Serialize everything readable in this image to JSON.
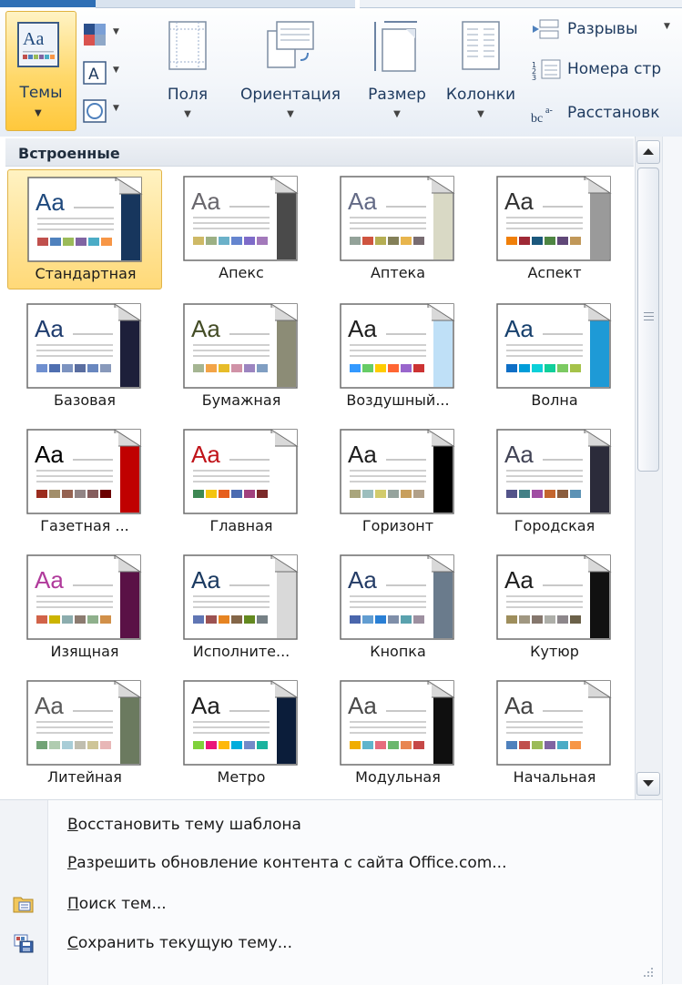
{
  "ribbon": {
    "themes_label": "Темы",
    "buttons": {
      "margins": "Поля",
      "orientation": "Ориентация",
      "size": "Размер",
      "columns": "Колонки"
    },
    "page_setup_rows": {
      "breaks": "Разрывы",
      "line_numbers": "Номера стр",
      "hyphenation": "Расстановк"
    }
  },
  "gallery": {
    "section_header": "Встроенные",
    "selected": "Стандартная",
    "themes": [
      {
        "name": "Стандартная",
        "title_color": "#1f497d",
        "accent_strip": "#17365d",
        "swatches": [
          "#c0504d",
          "#4f81bd",
          "#9bbb59",
          "#8064a2",
          "#4bacc6",
          "#f79646"
        ]
      },
      {
        "name": "Апекс",
        "title_color": "#69676d",
        "accent_strip": "#4a4a4a",
        "swatches": [
          "#ceb966",
          "#9cb084",
          "#6bb1c9",
          "#6585cf",
          "#7e6bc9",
          "#a379bb"
        ]
      },
      {
        "name": "Аптека",
        "title_color": "#646b86",
        "accent_strip": "#d9d9c5",
        "swatches": [
          "#93a299",
          "#cf543f",
          "#b5ae53",
          "#848058",
          "#e8b54d",
          "#786c71"
        ]
      },
      {
        "name": "Аспект",
        "title_color": "#323232",
        "accent_strip": "#9a9a9a",
        "swatches": [
          "#f07f09",
          "#9f2936",
          "#1b587c",
          "#4e8542",
          "#604878",
          "#c19859"
        ]
      },
      {
        "name": "Базовая",
        "title_color": "#1f3c6e",
        "accent_strip": "#1d1f3a",
        "swatches": [
          "#6f8fcf",
          "#4f6fb0",
          "#7c93c0",
          "#5a6ea0",
          "#6987bf",
          "#8899bb"
        ]
      },
      {
        "name": "Бумажная",
        "title_color": "#444d26",
        "accent_strip": "#8c8c76",
        "swatches": [
          "#a5b592",
          "#f3a447",
          "#e7bc29",
          "#d092a7",
          "#9c85c0",
          "#809ec2"
        ]
      },
      {
        "name": "Воздушный...",
        "title_color": "#1f1f1f",
        "accent_strip": "#bfe0f7",
        "swatches": [
          "#3399ff",
          "#66cc66",
          "#ffcc00",
          "#ff6633",
          "#9966cc",
          "#cc3333"
        ]
      },
      {
        "name": "Волна",
        "title_color": "#17406d",
        "accent_strip": "#1e9ad6",
        "swatches": [
          "#0f6fc6",
          "#009dd9",
          "#0bd0d9",
          "#10cf9b",
          "#7cca62",
          "#a5c249"
        ]
      },
      {
        "name": "Газетная ...",
        "title_color": "#000000",
        "accent_strip": "#c00000",
        "swatches": [
          "#9b2d1f",
          "#a28e6a",
          "#956251",
          "#918485",
          "#855d5d",
          "#6b0000"
        ]
      },
      {
        "name": "Главная",
        "title_color": "#c0141a",
        "accent_strip": "#ffffff",
        "swatches": [
          "#3e8853",
          "#f4c40f",
          "#e65f1e",
          "#4b6bb1",
          "#a1417e",
          "#7b2a2a"
        ]
      },
      {
        "name": "Горизонт",
        "title_color": "#1f1f1f",
        "accent_strip": "#000000",
        "swatches": [
          "#a9a57c",
          "#9cbebd",
          "#d2cb6c",
          "#95a39d",
          "#c89f5d",
          "#b1a089"
        ]
      },
      {
        "name": "Городская",
        "title_color": "#424456",
        "accent_strip": "#2b2b3a",
        "swatches": [
          "#53548a",
          "#438086",
          "#a04da3",
          "#c4652d",
          "#8b5d3d",
          "#5c92b5"
        ]
      },
      {
        "name": "Изящная",
        "title_color": "#b03a9b",
        "accent_strip": "#5a1146",
        "swatches": [
          "#d16349",
          "#ccb400",
          "#8cadae",
          "#8c7b70",
          "#8fb08c",
          "#d19049"
        ]
      },
      {
        "name": "Исполните...",
        "title_color": "#1b3a61",
        "accent_strip": "#d9d9d9",
        "swatches": [
          "#6076b4",
          "#9c5252",
          "#e68422",
          "#846648",
          "#63891f",
          "#758085"
        ]
      },
      {
        "name": "Кнопка",
        "title_color": "#243c66",
        "accent_strip": "#6a7b8c",
        "swatches": [
          "#4a66ac",
          "#629dd1",
          "#297fd5",
          "#7f8fa9",
          "#5aa2ae",
          "#9d90a0"
        ]
      },
      {
        "name": "Кутюр",
        "title_color": "#1e1e1e",
        "accent_strip": "#111111",
        "swatches": [
          "#9e8e5c",
          "#a09781",
          "#85776d",
          "#aeafa9",
          "#8d878b",
          "#6b6149"
        ]
      },
      {
        "name": "Литейная",
        "title_color": "#5a5a5a",
        "accent_strip": "#6b7a5f",
        "swatches": [
          "#72a376",
          "#b0ccb0",
          "#a8cdd7",
          "#c0beaf",
          "#cec597",
          "#e8b7b7"
        ]
      },
      {
        "name": "Метро",
        "title_color": "#1e1e1e",
        "accent_strip": "#0b1d3a",
        "swatches": [
          "#7fd13b",
          "#ea157a",
          "#feb80a",
          "#00addc",
          "#738ac8",
          "#1ab39f"
        ]
      },
      {
        "name": "Модульная",
        "title_color": "#4a4a4a",
        "accent_strip": "#0f0f0f",
        "swatches": [
          "#f0ad00",
          "#60b5cc",
          "#e66c7d",
          "#6bb76d",
          "#e88651",
          "#c64847"
        ]
      },
      {
        "name": "Начальная",
        "title_color": "#444444",
        "accent_strip": "#ffffff",
        "swatches": [
          "#4f81bd",
          "#c0504d",
          "#9bbb59",
          "#8064a2",
          "#4bacc6",
          "#f79646"
        ]
      }
    ]
  },
  "menu": {
    "items": [
      {
        "text": "Восстановить тему шаблона",
        "underline": "В",
        "rest": "осстановить тему шаблона",
        "icon": ""
      },
      {
        "text": "Разрешить обновление контента с сайта Office.com...",
        "underline": "Р",
        "rest": "азрешить обновление контента с сайта Office.com...",
        "icon": ""
      },
      {
        "text": "Поиск тем...",
        "underline": "П",
        "rest": "оиск тем...",
        "icon": "folder-search-icon"
      },
      {
        "text": "Сохранить текущую тему...",
        "underline": "С",
        "rest": "охранить текущую тему...",
        "icon": "save-theme-icon"
      }
    ]
  },
  "colors": {
    "ribbon_text": "#1e3a5f",
    "selected_fill": "#ffd978",
    "selected_border": "#e1b449",
    "header_bg": "#e6eaf0"
  }
}
